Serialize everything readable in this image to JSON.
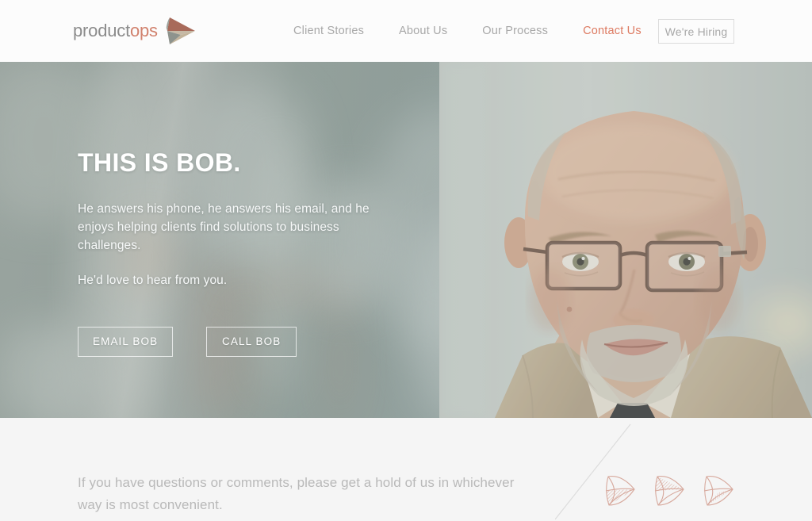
{
  "header": {
    "logo": {
      "name": "productops-logo",
      "word_part1": "product",
      "word_part2": "ops",
      "mark": "triangle-play-mark"
    },
    "nav": [
      {
        "label": "Client Stories",
        "active": false,
        "name": "nav-client-stories"
      },
      {
        "label": "About Us",
        "active": false,
        "name": "nav-about-us"
      },
      {
        "label": "Our Process",
        "active": false,
        "name": "nav-our-process"
      },
      {
        "label": "Contact Us",
        "active": true,
        "name": "nav-contact-us"
      }
    ],
    "hiring_button": "We're Hiring",
    "colors": {
      "accent": "#dd7a61",
      "nav_text": "#a8a8a8",
      "bg": "#fcfcfc",
      "border": "#dcdcdc"
    }
  },
  "hero": {
    "title": "THIS IS BOB.",
    "paragraph_line1": "He answers his phone, he answers his email, and he enjoys helping clients find solutions to business challenges.",
    "paragraph_line2": "He'd love to hear from you.",
    "buttons": [
      {
        "label": "EMAIL BOB",
        "name": "email-bob-button"
      },
      {
        "label": "CALL BOB",
        "name": "call-bob-button"
      }
    ],
    "image_alt": "Photo of Bob, a smiling bald man with glasses and a grey beard wearing a tan collared shirt",
    "colors": {
      "bg_tint": "#93a09b",
      "text": "#ffffff"
    }
  },
  "lower": {
    "text": "If you have questions or comments, please get a hold of us in whichever way is most convenient.",
    "decor": {
      "triangle_count": 3,
      "triangle_color": "#d7a99d",
      "line_color": "#dcdcdc"
    },
    "colors": {
      "bg": "#f5f5f5",
      "text": "#b9b9b9"
    }
  }
}
